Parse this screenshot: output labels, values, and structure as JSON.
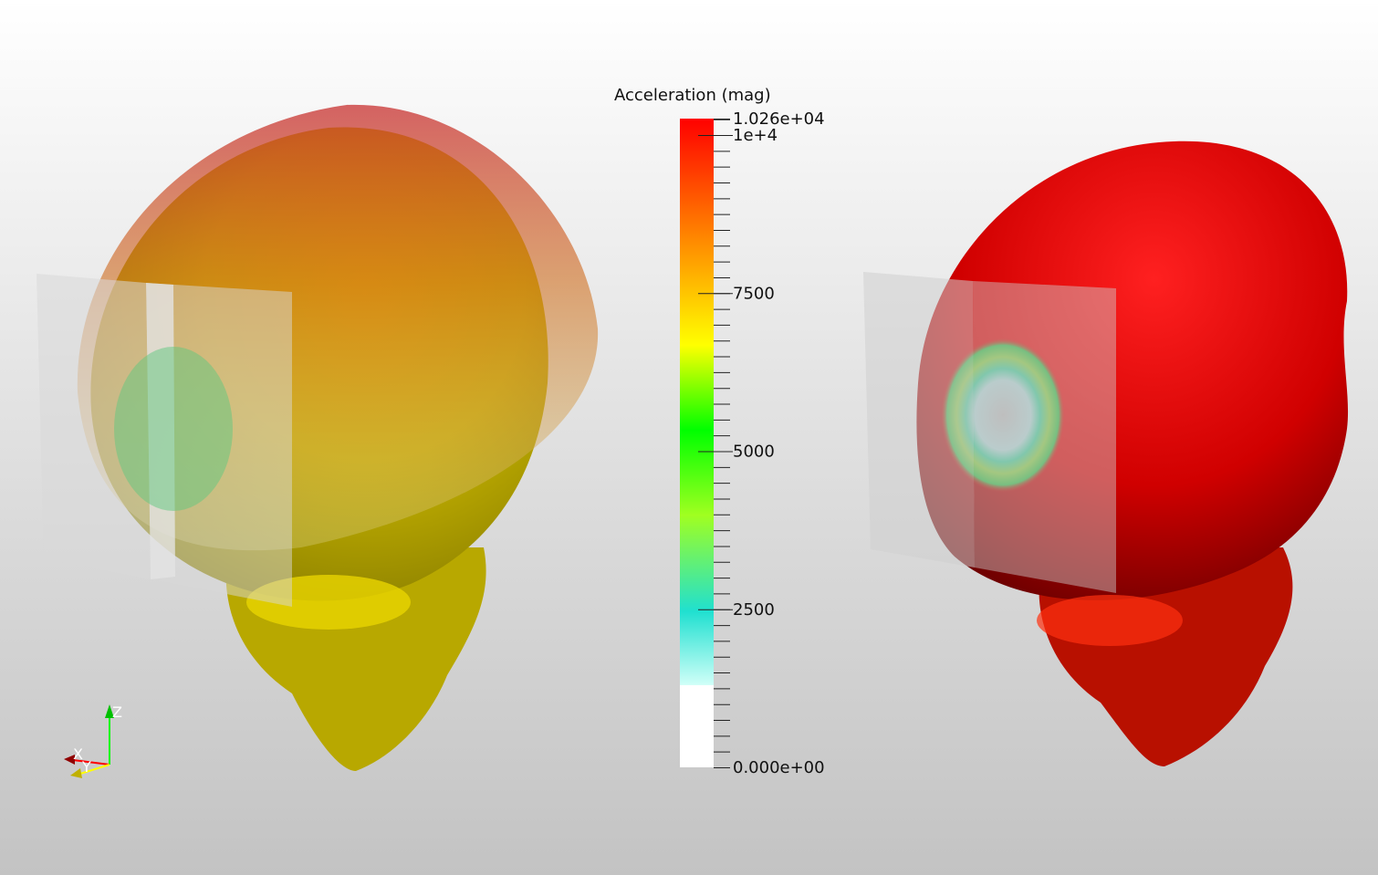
{
  "colorbar": {
    "title": "Acceleration (mag)",
    "range": [
      0,
      10260
    ],
    "max_label": "1.026e+04",
    "min_label": "0.000e+00",
    "ticks": [
      {
        "value": 10000,
        "label": "1e+4"
      },
      {
        "value": 7500,
        "label": "7500"
      },
      {
        "value": 5000,
        "label": "5000"
      },
      {
        "value": 2500,
        "label": "2500"
      }
    ],
    "minor_tick_step": 250,
    "below_range_color": "#ffffff",
    "colors": [
      "#ff0000",
      "#ff8000",
      "#ffff00",
      "#00ff00",
      "#a0ff20",
      "#20e0d0",
      "#d0fff8"
    ]
  },
  "axes_triad": {
    "x": "X",
    "y": "Y",
    "z": "Z",
    "x_color": "#ff0000",
    "y_color": "#ffff00",
    "z_color": "#00ff00"
  },
  "views": [
    {
      "name": "left-view",
      "head_color": "#d4b800"
    },
    {
      "name": "right-view",
      "head_color": "#e00000"
    }
  ]
}
